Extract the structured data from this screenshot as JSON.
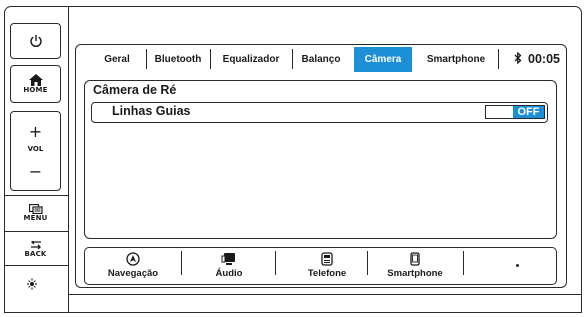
{
  "hardware": {
    "power_label": "",
    "home_label": "HOME",
    "vol_plus": "+",
    "vol_label": "VOL",
    "vol_minus": "−",
    "menu_label": "MENU",
    "back_label": "BACK"
  },
  "tabs": [
    {
      "label": "Geral",
      "active": false
    },
    {
      "label": "Bluetooth",
      "active": false
    },
    {
      "label": "Equalizador",
      "active": false
    },
    {
      "label": "Balanço",
      "active": false
    },
    {
      "label": "Câmera",
      "active": true
    },
    {
      "label": "Smartphone",
      "active": false
    }
  ],
  "status": {
    "bluetooth_icon": "bluetooth-icon",
    "time": "00:05"
  },
  "section": {
    "title": "Câmera de Ré",
    "rows": [
      {
        "label": "Linhas Guias",
        "toggle_value": "OFF"
      }
    ]
  },
  "bottom_nav": [
    {
      "label": "Navegação",
      "icon": "navigation-icon"
    },
    {
      "label": "Áudio",
      "icon": "audio-icon"
    },
    {
      "label": "Telefone",
      "icon": "phone-icon"
    },
    {
      "label": "Smartphone",
      "icon": "smartphone-icon"
    }
  ],
  "colors": {
    "accent": "#1c8fd6",
    "border": "#2a2a2a",
    "background": "#ffffff"
  }
}
